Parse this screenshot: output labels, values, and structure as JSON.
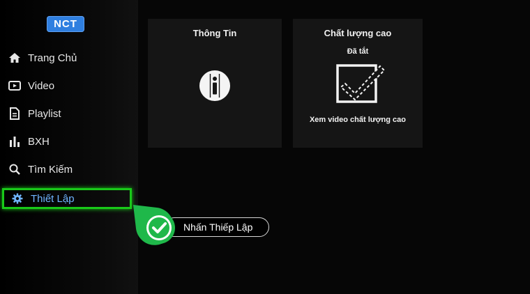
{
  "logo": {
    "text": "NCT"
  },
  "sidebar": {
    "items": [
      {
        "label": "Trang Chủ",
        "icon": "home-icon"
      },
      {
        "label": "Video",
        "icon": "video-icon"
      },
      {
        "label": "Playlist",
        "icon": "document-icon"
      },
      {
        "label": "BXH",
        "icon": "bar-chart-icon"
      },
      {
        "label": "Tìm Kiếm",
        "icon": "search-icon"
      },
      {
        "label": "Thiết Lập",
        "icon": "gear-icon",
        "selected": true
      }
    ]
  },
  "cards": {
    "info": {
      "title": "Thông Tin",
      "icon": "info-icon"
    },
    "quality": {
      "title": "Chất lượng cao",
      "status": "Đã tắt",
      "description": "Xem video chất lượng cao",
      "icon": "checkbox-icon"
    }
  },
  "annotation": {
    "text": "Nhấn Thiếp Lập",
    "icon": "check-circle-icon"
  },
  "colors": {
    "selection_border": "#19c919",
    "selected_text": "#6fb4ff",
    "logo_bg": "#2f7fe0",
    "callout_green": "#1fb84a"
  }
}
